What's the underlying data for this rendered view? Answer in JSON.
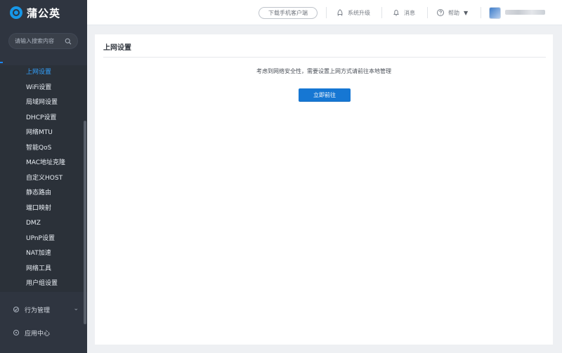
{
  "brand": {
    "name": "蒲公英"
  },
  "sidebar": {
    "search": {
      "placeholder": "请输入搜索内容"
    },
    "items": [
      {
        "label": "上网设置",
        "active": true
      },
      {
        "label": "WiFi设置"
      },
      {
        "label": "局域网设置"
      },
      {
        "label": "DHCP设置"
      },
      {
        "label": "网络MTU"
      },
      {
        "label": "智能QoS"
      },
      {
        "label": "MAC地址克隆"
      },
      {
        "label": "自定义HOST"
      },
      {
        "label": "静态路由"
      },
      {
        "label": "端口映射"
      },
      {
        "label": "DMZ"
      },
      {
        "label": "UPnP设置"
      },
      {
        "label": "NAT加速"
      },
      {
        "label": "网络工具"
      },
      {
        "label": "用户组设置"
      }
    ],
    "groups": [
      {
        "label": "行为管理"
      },
      {
        "label": "应用中心"
      }
    ]
  },
  "topbar": {
    "download_label": "下载手机客户端",
    "upgrade_label": "系统升级",
    "messages_label": "消息",
    "help_label": "帮助"
  },
  "main": {
    "title": "上网设置",
    "notice": "考虑到网络安全性，需要设置上网方式请前往本地管理",
    "button_label": "立即前往"
  },
  "colors": {
    "sidebar_bg": "#2f3540",
    "active_item": "#33a2ff",
    "primary_button": "#1677d3",
    "page_bg": "#eef0f3"
  }
}
